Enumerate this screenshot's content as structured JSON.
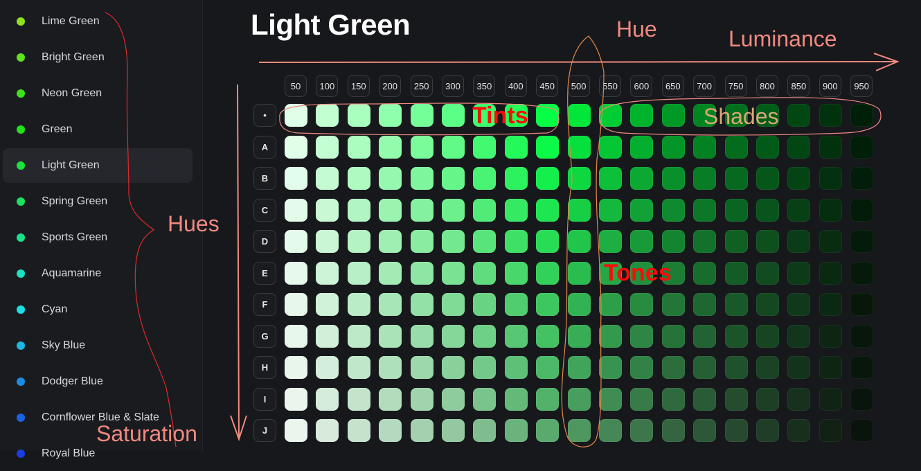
{
  "sidebar": {
    "items": [
      {
        "label": "Lime Green",
        "color": "#8ee21b"
      },
      {
        "label": "Bright Green",
        "color": "#5ee21b"
      },
      {
        "label": "Neon Green",
        "color": "#3ee21b"
      },
      {
        "label": "Green",
        "color": "#1fe21b"
      },
      {
        "label": "Light Green",
        "color": "#1be23a",
        "active": true
      },
      {
        "label": "Spring Green",
        "color": "#1be25c"
      },
      {
        "label": "Sports Green",
        "color": "#1be28a"
      },
      {
        "label": "Aquamarine",
        "color": "#1be2be"
      },
      {
        "label": "Cyan",
        "color": "#1bdfe2"
      },
      {
        "label": "Sky Blue",
        "color": "#1bb9e2"
      },
      {
        "label": "Dodger Blue",
        "color": "#1b8ce2"
      },
      {
        "label": "Cornflower Blue & Slate",
        "color": "#1b62e2"
      },
      {
        "label": "Royal Blue",
        "color": "#1b3de2"
      }
    ]
  },
  "page": {
    "title": "Light Green"
  },
  "grid": {
    "columns": [
      "50",
      "100",
      "150",
      "200",
      "250",
      "300",
      "350",
      "400",
      "450",
      "500",
      "550",
      "600",
      "650",
      "700",
      "750",
      "800",
      "850",
      "900",
      "950"
    ],
    "rows": [
      "•",
      "A",
      "B",
      "C",
      "D",
      "E",
      "F",
      "G",
      "H",
      "I",
      "J"
    ],
    "hue": 135,
    "row_saturation": [
      100,
      95,
      88,
      80,
      72,
      64,
      56,
      50,
      44,
      38,
      32
    ],
    "lightness": [
      94,
      88,
      83,
      78,
      73,
      68,
      62,
      56,
      51,
      45,
      40,
      35,
      30,
      26,
      22,
      18,
      14,
      10,
      6
    ]
  },
  "annotations": {
    "hue": "Hue",
    "luminance": "Luminance",
    "hues": "Hues",
    "saturation": "Saturation",
    "tints": "Tints",
    "shades": "Shades",
    "tones": "Tones"
  }
}
